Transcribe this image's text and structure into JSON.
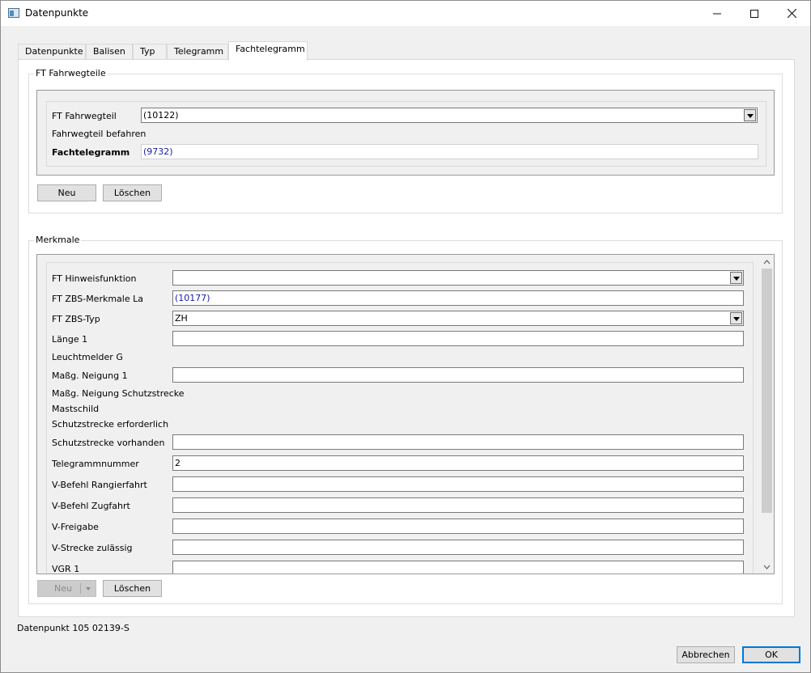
{
  "window": {
    "title": "Datenpunkte",
    "icons": {
      "app": "window-app-icon",
      "minimize": "minimize-icon",
      "maximize": "maximize-icon",
      "close": "close-icon"
    }
  },
  "tabs": [
    {
      "label": "Datenpunkte"
    },
    {
      "label": "Balisen"
    },
    {
      "label": "Typ"
    },
    {
      "label": "Telegramm"
    },
    {
      "label": "Fachtelegramm",
      "active": true
    }
  ],
  "fahrwegteile": {
    "legend": "FT Fahrwegteile",
    "fields": {
      "ft_fahrwegteil_label": "FT Fahrwegteil",
      "ft_fahrwegteil_value": "(10122)",
      "befahren_label": "Fahrwegteil befahren",
      "fachtelegramm_label": "Fachtelegramm",
      "fachtelegramm_value": "(9732)"
    },
    "buttons": {
      "new": "Neu",
      "delete": "Löschen"
    }
  },
  "merkmale": {
    "legend": "Merkmale",
    "rows": {
      "hinweisfunktion": {
        "label": "FT Hinweisfunktion",
        "value": ""
      },
      "zbs_merkmale": {
        "label": "FT ZBS-Merkmale La",
        "value": "(10177)"
      },
      "zbs_typ": {
        "label": "FT ZBS-Typ",
        "value": "ZH"
      },
      "laenge1": {
        "label": "Länge 1",
        "value": ""
      },
      "leuchtmelder": {
        "label": "Leuchtmelder G"
      },
      "neigung1": {
        "label": "Maßg. Neigung 1",
        "value": ""
      },
      "neigung_schutz": {
        "label": "Maßg. Neigung Schutzstrecke"
      },
      "mastschild": {
        "label": "Mastschild"
      },
      "schutz_erf": {
        "label": "Schutzstrecke erforderlich"
      },
      "schutz_vorh": {
        "label": "Schutzstrecke vorhanden",
        "value": ""
      },
      "telegrammnummer": {
        "label": "Telegrammnummer",
        "value": "2"
      },
      "v_rangier": {
        "label": "V-Befehl Rangierfahrt",
        "value": ""
      },
      "v_zug": {
        "label": "V-Befehl Zugfahrt",
        "value": ""
      },
      "v_freigabe": {
        "label": "V-Freigabe",
        "value": ""
      },
      "v_strecke": {
        "label": "V-Strecke zulässig",
        "value": ""
      },
      "vgr1": {
        "label": "VGR 1",
        "value": ""
      }
    },
    "buttons": {
      "new": "Neu",
      "delete": "Löschen"
    }
  },
  "status": "Datenpunkt 105 02139-S",
  "footer": {
    "cancel": "Abbrechen",
    "ok": "OK"
  },
  "colors": {
    "link_value": "#1a1aa6",
    "ok_border": "#0078d7"
  }
}
